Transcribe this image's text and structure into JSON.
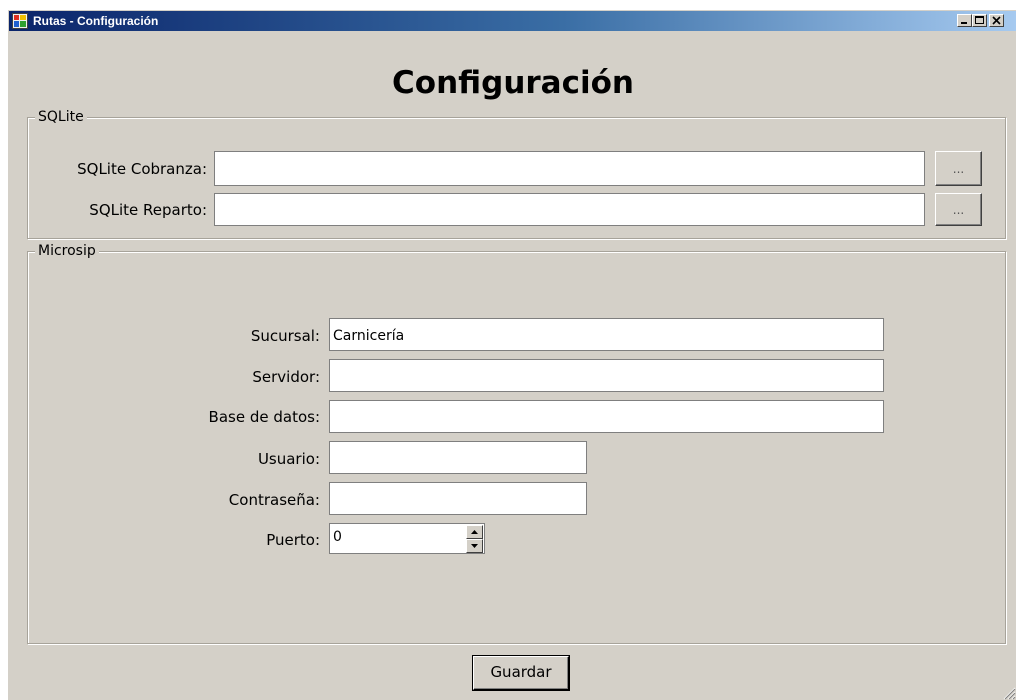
{
  "window": {
    "title": "Rutas - Configuración",
    "icon": "app-window-icon",
    "controls": [
      "minimize-icon",
      "maximize-icon",
      "close-icon"
    ]
  },
  "page_title": "Configuración",
  "sqlite": {
    "legend": "SQLite",
    "cobranza_label": "SQLite Cobranza:",
    "cobranza_value": "",
    "reparto_label": "SQLite Reparto:",
    "reparto_value": "",
    "browse_label": "..."
  },
  "microsip": {
    "legend": "Microsip",
    "sucursal_label": "Sucursal:",
    "sucursal_value": "Carnicería",
    "servidor_label": "Servidor:",
    "servidor_value": "",
    "base_label": "Base de datos:",
    "base_value": "",
    "usuario_label": "Usuario:",
    "usuario_value": "",
    "contrasena_label": "Contraseña:",
    "contrasena_value": "",
    "puerto_label": "Puerto:",
    "puerto_value": "0"
  },
  "actions": {
    "save_label": "Guardar"
  },
  "colors": {
    "titlebar_start": "#0a246a",
    "titlebar_end": "#a6caf0",
    "face": "#d4d0c8"
  }
}
